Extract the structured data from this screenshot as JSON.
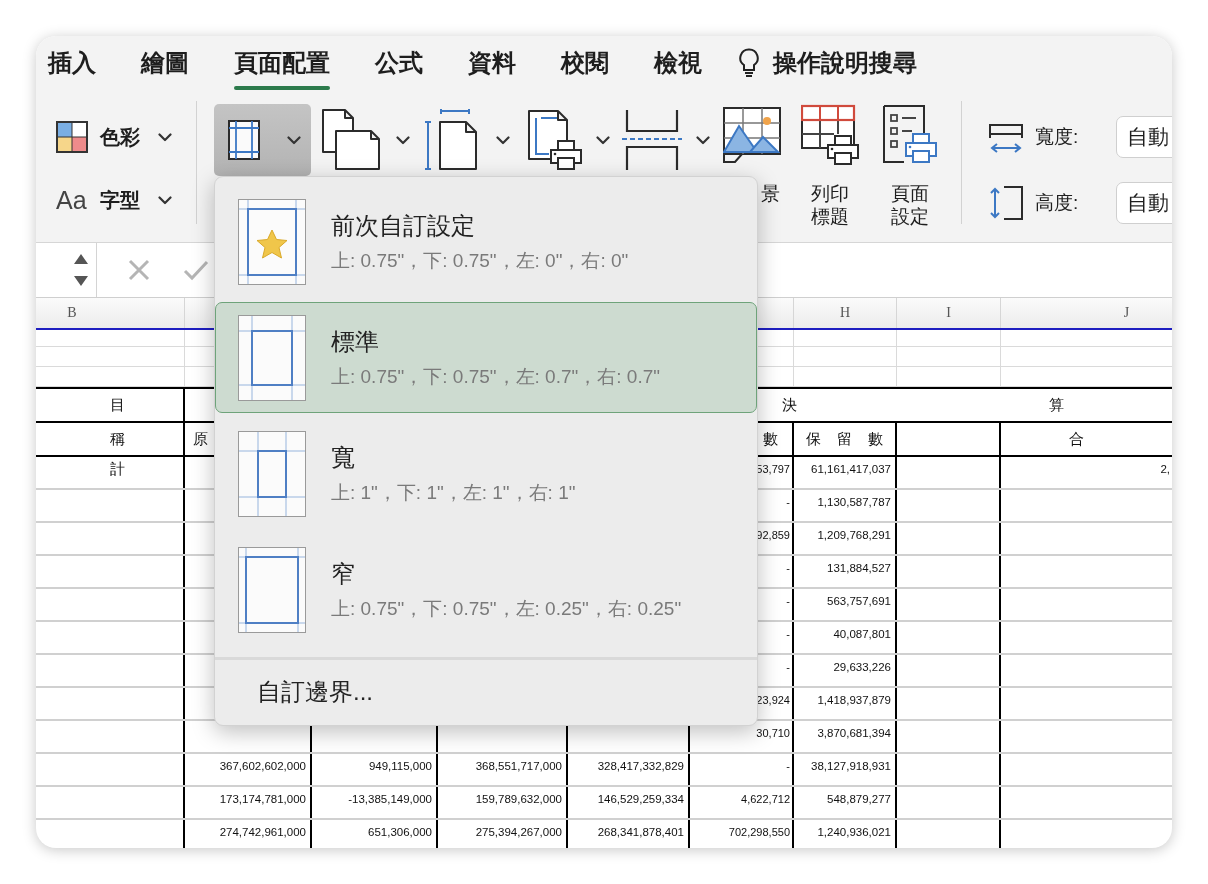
{
  "tabs": [
    {
      "label": "插入",
      "selected": false
    },
    {
      "label": "繪圖",
      "selected": false
    },
    {
      "label": "頁面配置",
      "selected": true
    },
    {
      "label": "公式",
      "selected": false
    },
    {
      "label": "資料",
      "selected": false
    },
    {
      "label": "校閱",
      "selected": false
    },
    {
      "label": "檢視",
      "selected": false
    }
  ],
  "tell_me": {
    "label": "操作說明搜尋"
  },
  "ribbon": {
    "theme": [
      {
        "kind": "colors",
        "label": "色彩"
      },
      {
        "kind": "fonts",
        "icon_text": "Aa",
        "label": "字型"
      }
    ],
    "tools": [
      {
        "kind": "margins",
        "pressed": true,
        "dropdown": true
      },
      {
        "kind": "orientation",
        "pressed": false,
        "dropdown": true
      },
      {
        "kind": "size",
        "pressed": false,
        "dropdown": true
      },
      {
        "kind": "print_area",
        "pressed": false,
        "dropdown": true
      },
      {
        "kind": "breaks",
        "pressed": false,
        "dropdown": true
      },
      {
        "kind": "background",
        "pressed": false,
        "dropdown": false,
        "label": "景"
      },
      {
        "kind": "print_titles",
        "pressed": false,
        "dropdown": false,
        "label": "列印標題"
      },
      {
        "kind": "page_setup",
        "pressed": false,
        "dropdown": false,
        "label": "頁面設定"
      }
    ],
    "scale": [
      {
        "kind": "width",
        "label": "寬度:",
        "value": "自動"
      },
      {
        "kind": "height",
        "label": "高度:",
        "value": "自動"
      }
    ]
  },
  "sheet": {
    "column_headers": {
      "b": "B",
      "h": "H",
      "i": "I",
      "j": "J"
    },
    "group_header": {
      "left": "目",
      "middle": "決",
      "right": "算"
    },
    "sub_header": {
      "b": "稱",
      "c": "原",
      "g": "數",
      "h": "保 留 數",
      "j": "合"
    },
    "rows": [
      {
        "b": "計",
        "g": "53,797",
        "h": "61,161,417,037",
        "j": "2,"
      },
      {
        "g": "-",
        "h": "1,130,587,787"
      },
      {
        "g": "92,859",
        "h": "1,209,768,291"
      },
      {
        "g": "-",
        "h": "131,884,527"
      },
      {
        "g": "-",
        "h": "563,757,691"
      },
      {
        "g": "-",
        "h": "40,087,801"
      },
      {
        "g": "-",
        "h": "29,633,226"
      },
      {
        "g": "23,924",
        "h": "1,418,937,879"
      },
      {
        "g": "30,710",
        "h": "3,870,681,394"
      },
      {
        "c": "367,602,602,000",
        "d": "949,115,000",
        "e": "368,551,717,000",
        "f": "328,417,332,829",
        "g": "-",
        "h": "38,127,918,931"
      },
      {
        "c": "173,174,781,000",
        "d": "-13,385,149,000",
        "e": "159,789,632,000",
        "f": "146,529,259,334",
        "g": "4,622,712",
        "h": "548,879,277"
      },
      {
        "c": "274,742,961,000",
        "d": "651,306,000",
        "e": "275,394,267,000",
        "f": "268,341,878,401",
        "g": "702,298,550",
        "h": "1,240,936,021"
      }
    ]
  },
  "margin_menu": {
    "items": [
      {
        "kind": "last_custom",
        "title": "前次自訂設定",
        "detail": "上: 0.75\"，下: 0.75\"，左: 0\"，右: 0\"",
        "selected": false
      },
      {
        "kind": "normal",
        "title": "標準",
        "detail": "上: 0.75\"，下: 0.75\"，左: 0.7\"，右: 0.7\"",
        "selected": true
      },
      {
        "kind": "wide",
        "title": "寬",
        "detail": "上: 1\"，下: 1\"，左: 1\"，右: 1\"",
        "selected": false
      },
      {
        "kind": "narrow",
        "title": "窄",
        "detail": "上: 0.75\"，下: 0.75\"，左: 0.25\"，右: 0.25\"",
        "selected": false
      }
    ],
    "custom_label": "自訂邊界..."
  }
}
